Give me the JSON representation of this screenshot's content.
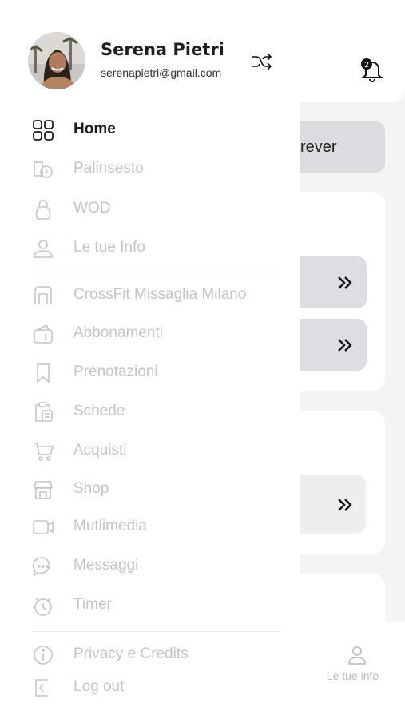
{
  "user": {
    "name": "Serena Pietri",
    "email": "serenapietri@gmail.com"
  },
  "header": {
    "notification_count": "2"
  },
  "background": {
    "button_partial_label": "rever",
    "bottom_nav_label": "Le tue info"
  },
  "menu": {
    "primary": [
      {
        "label": "Home",
        "icon": "home-grid-icon",
        "active": true
      },
      {
        "label": "Palinsesto",
        "icon": "schedule-icon",
        "active": false
      },
      {
        "label": "WOD",
        "icon": "kettlebell-icon",
        "active": false
      },
      {
        "label": "Le tue Info",
        "icon": "user-icon",
        "active": false
      }
    ],
    "secondary": [
      {
        "label": "CrossFit Missaglia Milano",
        "icon": "gym-door-icon"
      },
      {
        "label": "Abbonamenti",
        "icon": "wallet-icon"
      },
      {
        "label": "Prenotazioni",
        "icon": "bookmark-icon"
      },
      {
        "label": "Schede",
        "icon": "clipboard-icon"
      },
      {
        "label": "Acquisti",
        "icon": "cart-icon"
      },
      {
        "label": "Shop",
        "icon": "store-icon"
      },
      {
        "label": "Mutlimedia",
        "icon": "video-icon"
      },
      {
        "label": "Messaggi",
        "icon": "chat-icon"
      },
      {
        "label": "Timer",
        "icon": "stopwatch-icon"
      }
    ],
    "footer": [
      {
        "label": "Privacy e Credits",
        "icon": "info-icon"
      },
      {
        "label": "Log out",
        "icon": "logout-icon"
      }
    ]
  },
  "colors": {
    "active_text": "#1b1b20",
    "inactive_text": "#c4c4c8",
    "drawer_bg": "#ffffff",
    "app_bg": "#f4f4f6"
  }
}
